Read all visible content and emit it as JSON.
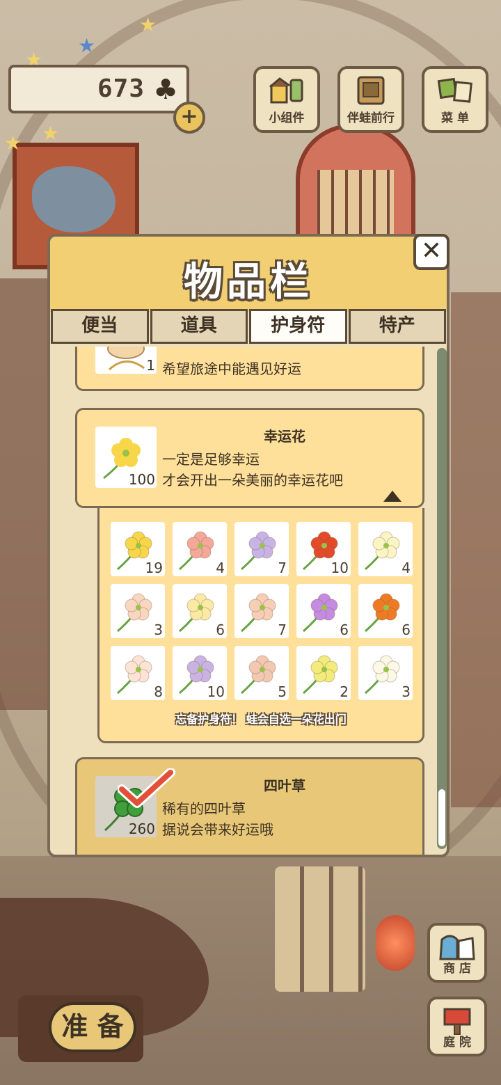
{
  "hud": {
    "clover_count": "673",
    "clover_icon": "clover-icon",
    "plus_label": "+"
  },
  "top_buttons": [
    {
      "label": "小组件",
      "icon": "widget-icon"
    },
    {
      "label": "伴蛙前行",
      "icon": "frog-companion-icon"
    },
    {
      "label": "菜 单",
      "icon": "menu-icon"
    }
  ],
  "panel": {
    "title": "物品栏",
    "close_label": "✕",
    "tabs": [
      "便当",
      "道具",
      "护身符",
      "特产"
    ],
    "active_tab": "护身符",
    "items": [
      {
        "name": "",
        "qty": "1",
        "desc_lines": [
          "希望旅途中能遇见好运"
        ]
      },
      {
        "name": "幸运花",
        "qty": "100",
        "desc_lines": [
          "一定是足够幸运",
          "才会开出一朵美丽的幸运花吧"
        ]
      },
      {
        "name": "四叶草",
        "qty": "260",
        "desc_lines": [
          "稀有的四叶草",
          "据说会带来好运哦"
        ],
        "selected": true
      }
    ],
    "flower_grid": {
      "counts": [
        "19",
        "4",
        "7",
        "10",
        "4",
        "3",
        "6",
        "7",
        "6",
        "6",
        "8",
        "10",
        "5",
        "2",
        "3"
      ],
      "colors": [
        "#f7d64a",
        "#f4a89a",
        "#c7b3e6",
        "#e24a2a",
        "#fbf4c4",
        "#f8d6bf",
        "#fbeaa6",
        "#f6cdb5",
        "#c48be0",
        "#ee7a25",
        "#fbe3d6",
        "#c8b3e3",
        "#f3c8b3",
        "#f3eb7c",
        "#fbf8e6"
      ],
      "hint": "忘备护身符！ 蛙会自选一朵花出门"
    }
  },
  "bottom": {
    "ready_label": "准 备",
    "shop_label": "商 店",
    "yard_label": "庭 院"
  }
}
